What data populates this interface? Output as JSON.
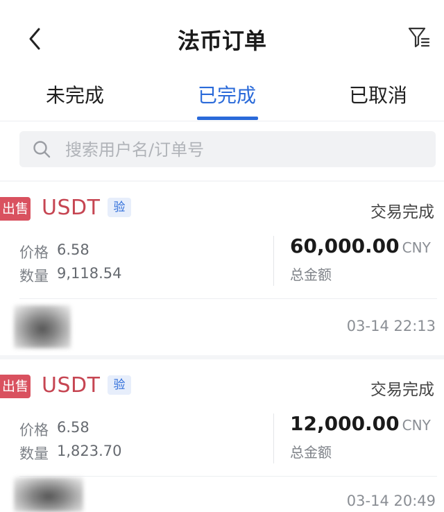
{
  "header": {
    "title": "法币订单"
  },
  "tabs": [
    {
      "label": "未完成"
    },
    {
      "label": "已完成",
      "active": true
    },
    {
      "label": "已取消"
    }
  ],
  "search": {
    "placeholder": "搜索用户名/订单号"
  },
  "orders": [
    {
      "side": "出售",
      "coin": "USDT",
      "verify": "验",
      "status": "交易完成",
      "price_label": "价格",
      "price": "6.58",
      "qty_label": "数量",
      "qty": "9,118.54",
      "amount": "60,000.00",
      "currency": "CNY",
      "amount_label": "总金额",
      "time": "03-14 22:13"
    },
    {
      "side": "出售",
      "coin": "USDT",
      "verify": "验",
      "status": "交易完成",
      "price_label": "价格",
      "price": "6.58",
      "qty_label": "数量",
      "qty": "1,823.70",
      "amount": "12,000.00",
      "currency": "CNY",
      "amount_label": "总金额",
      "time": "03-14 20:49"
    }
  ],
  "colors": {
    "accent": "#2a6ad9",
    "sell": "#d9515f",
    "coin": "#c64552"
  }
}
